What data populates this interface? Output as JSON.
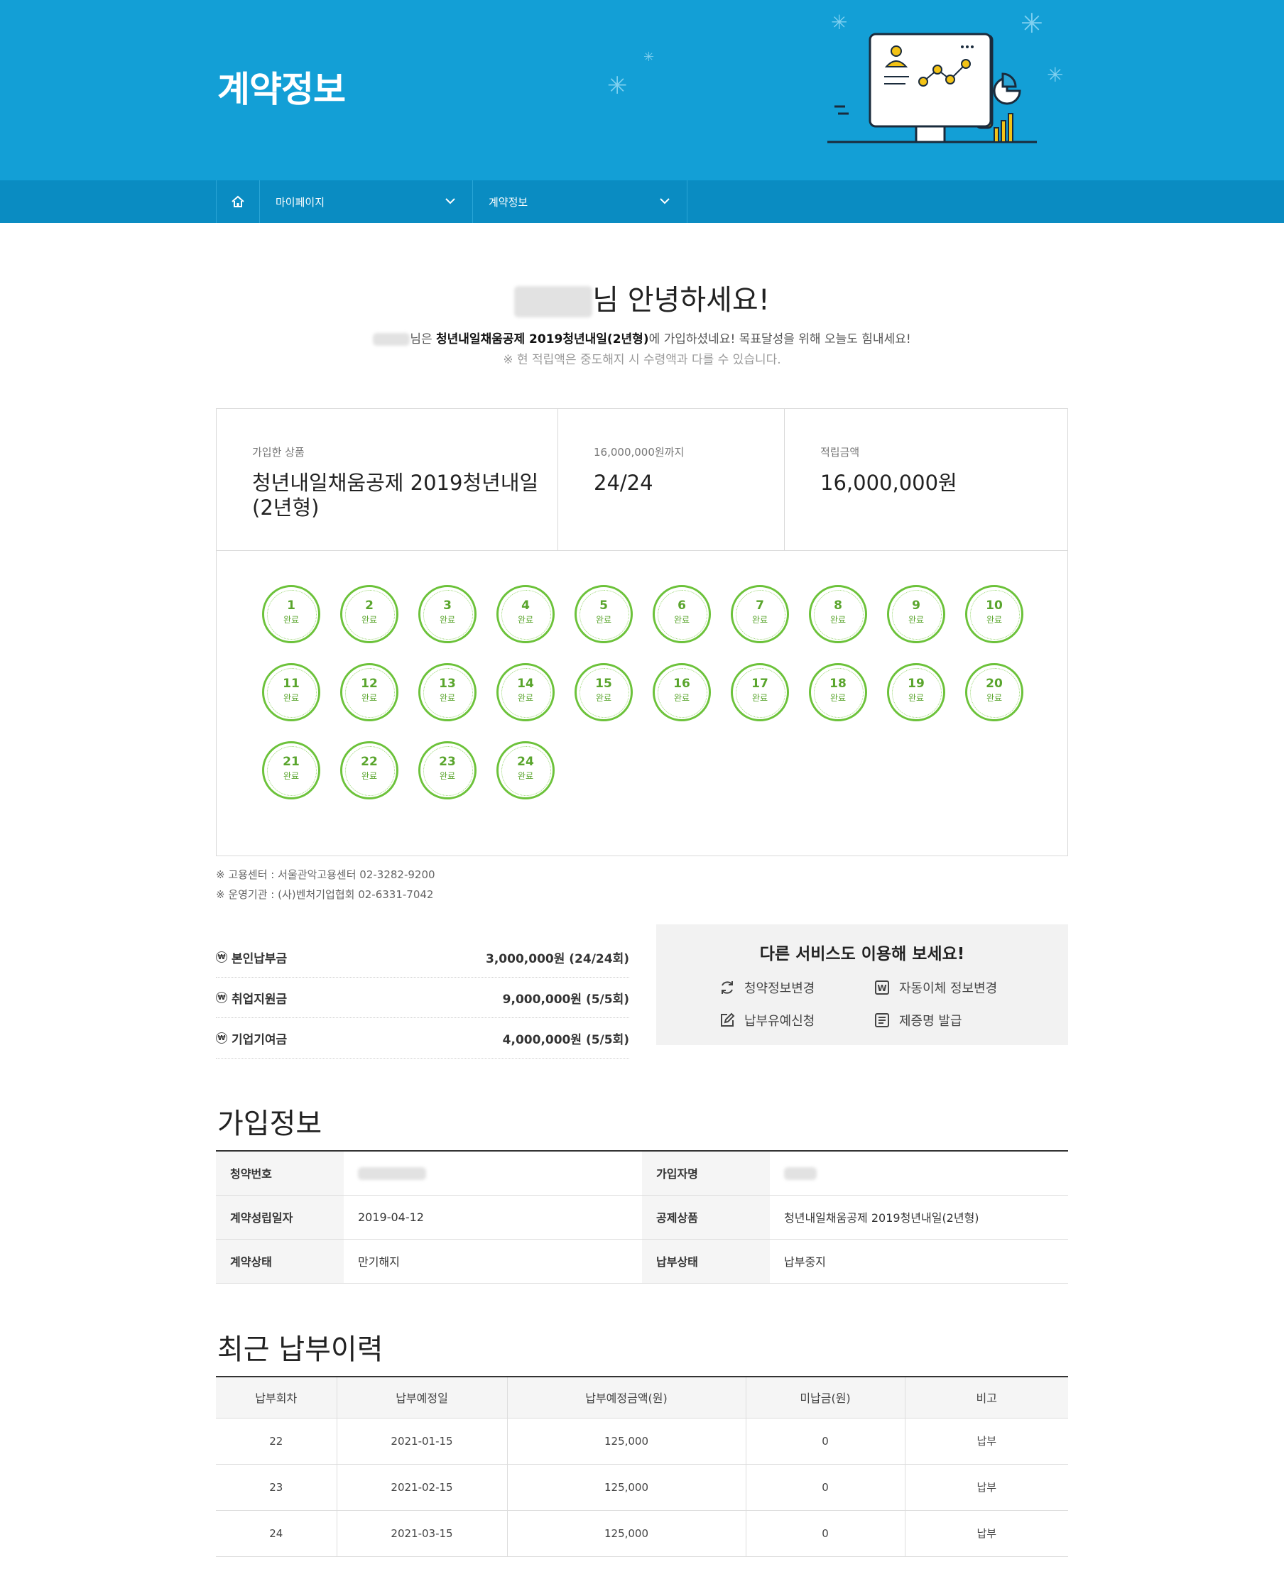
{
  "header": {
    "title": "계약정보"
  },
  "nav": {
    "home_icon": "home-icon",
    "menu1": "마이페이지",
    "menu2": "계약정보"
  },
  "greeting": {
    "suffix": "님 안녕하세요!",
    "line1_pre": "님은 ",
    "line1_product": "청년내일채움공제 2019청년내일(2년형)",
    "line1_post": "에 가입하셨네요! 목표달성을 위해 오늘도 힘내세요!",
    "line2": "※ 현 적립액은 중도해지 시 수령액과 다를 수 있습니다."
  },
  "summary": {
    "product_label": "가입한 상품",
    "product_value_1": "청년내일채움공제 2019청년내일",
    "product_value_2": "(2년형)",
    "target_label": "16,000,000원까지",
    "target_value": "24/24",
    "amount_label": "적립금액",
    "amount_value": "16,000,000원"
  },
  "payments": [
    {
      "n": "1",
      "s": "완료"
    },
    {
      "n": "2",
      "s": "완료"
    },
    {
      "n": "3",
      "s": "완료"
    },
    {
      "n": "4",
      "s": "완료"
    },
    {
      "n": "5",
      "s": "완료"
    },
    {
      "n": "6",
      "s": "완료"
    },
    {
      "n": "7",
      "s": "완료"
    },
    {
      "n": "8",
      "s": "완료"
    },
    {
      "n": "9",
      "s": "완료"
    },
    {
      "n": "10",
      "s": "완료"
    },
    {
      "n": "11",
      "s": "완료"
    },
    {
      "n": "12",
      "s": "완료"
    },
    {
      "n": "13",
      "s": "완료"
    },
    {
      "n": "14",
      "s": "완료"
    },
    {
      "n": "15",
      "s": "완료"
    },
    {
      "n": "16",
      "s": "완료"
    },
    {
      "n": "17",
      "s": "완료"
    },
    {
      "n": "18",
      "s": "완료"
    },
    {
      "n": "19",
      "s": "완료"
    },
    {
      "n": "20",
      "s": "완료"
    },
    {
      "n": "21",
      "s": "완료"
    },
    {
      "n": "22",
      "s": "완료"
    },
    {
      "n": "23",
      "s": "완료"
    },
    {
      "n": "24",
      "s": "완료"
    }
  ],
  "notes": {
    "center": "※ 고용센터 : 서울관악고용센터 02-3282-9200",
    "operator": "※ 운영기관 : (사)벤처기업협회 02-6331-7042"
  },
  "funds": [
    {
      "name": "본인납부금",
      "value": "3,000,000원 (24/24회)"
    },
    {
      "name": "취업지원금",
      "value": "9,000,000원 (5/5회)"
    },
    {
      "name": "기업기여금",
      "value": "4,000,000원 (5/5회)"
    }
  ],
  "services": {
    "title": "다른 서비스도 이용해 보세요!",
    "items": [
      "청약정보변경",
      "자동이체 정보변경",
      "납부유예신청",
      "제증명 발급"
    ]
  },
  "join_info": {
    "title": "가입정보",
    "rows": [
      {
        "k1": "청약번호",
        "v1": "",
        "k2": "가입자명",
        "v2": ""
      },
      {
        "k1": "계약성립일자",
        "v1": "2019-04-12",
        "k2": "공제상품",
        "v2": "청년내일채움공제 2019청년내일(2년형)"
      },
      {
        "k1": "계약상태",
        "v1": "만기해지",
        "k2": "납부상태",
        "v2": "납부중지"
      }
    ]
  },
  "history": {
    "title": "최근 납부이력",
    "headers": [
      "납부회차",
      "납부예정일",
      "납부예정금액(원)",
      "미납금(원)",
      "비고"
    ],
    "rows": [
      [
        "22",
        "2021-01-15",
        "125,000",
        "0",
        "납부"
      ],
      [
        "23",
        "2021-02-15",
        "125,000",
        "0",
        "납부"
      ],
      [
        "24",
        "2021-03-15",
        "125,000",
        "0",
        "납부"
      ]
    ]
  },
  "colors": {
    "banner": "#139fd6",
    "nav": "#0a8cc2",
    "complete_green": "#6cc23a"
  }
}
